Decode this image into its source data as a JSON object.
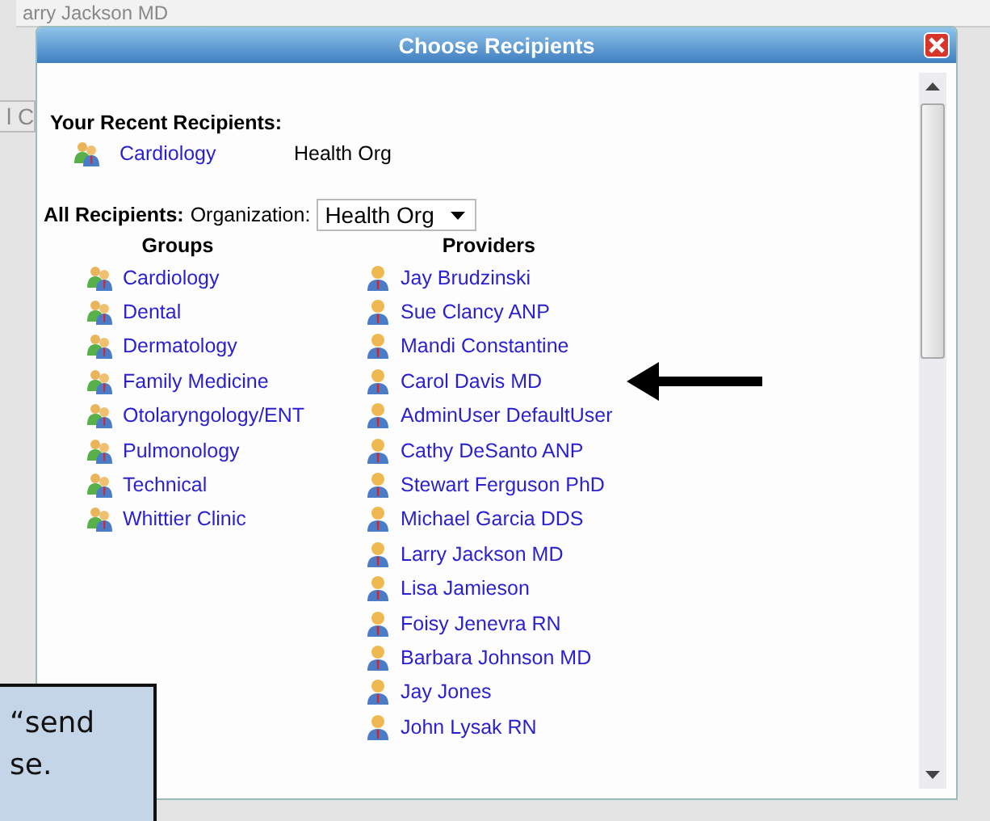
{
  "background": {
    "name_text": "arry Jackson MD",
    "button_text": "l C"
  },
  "dialog": {
    "title": "Choose Recipients",
    "recent": {
      "heading": "Your Recent Recipients:",
      "items": [
        {
          "name": "Cardiology",
          "org": "Health Org"
        }
      ]
    },
    "all": {
      "heading": "All Recipients:",
      "org_label": "Organization:",
      "org_value": "Health Org"
    },
    "groups": {
      "heading": "Groups",
      "items": [
        "Cardiology",
        "Dental",
        "Dermatology",
        "Family Medicine",
        "Otolaryngology/ENT",
        "Pulmonology",
        "Technical",
        "Whittier Clinic"
      ]
    },
    "providers": {
      "heading": "Providers",
      "items": [
        "Jay Brudzinski",
        "Sue Clancy ANP",
        "Mandi Constantine",
        "Carol Davis MD",
        "AdminUser DefaultUser",
        "Cathy DeSanto ANP",
        "Stewart Ferguson PhD",
        "Michael Garcia DDS",
        "Larry Jackson MD",
        "Lisa Jamieson",
        "Foisy Jenevra RN",
        "Barbara Johnson MD",
        "Jay Jones",
        "John Lysak RN"
      ]
    }
  },
  "callout": {
    "lines": [
      "“send",
      "se."
    ]
  }
}
